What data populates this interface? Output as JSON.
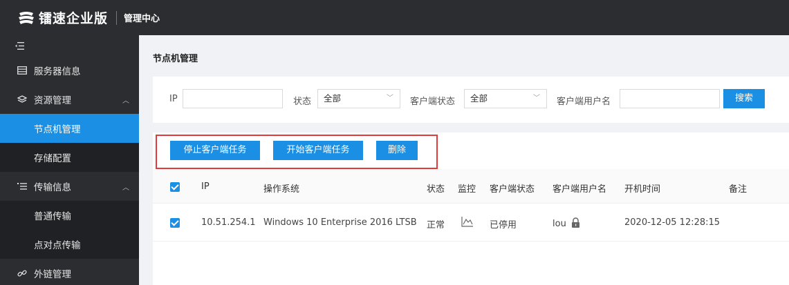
{
  "header": {
    "brand": "镭速企业版",
    "title": "管理中心"
  },
  "sidebar": {
    "toggle_icon": "menu-fold-icon",
    "items": [
      {
        "label": "服务器信息",
        "icon": "server-icon"
      },
      {
        "label": "资源管理",
        "icon": "layers-icon",
        "expanded": true,
        "children": [
          {
            "label": "节点机管理",
            "active": true
          },
          {
            "label": "存储配置"
          }
        ]
      },
      {
        "label": "传输信息",
        "icon": "list-icon",
        "expanded": true,
        "children": [
          {
            "label": "普通传输"
          },
          {
            "label": "点对点传输"
          }
        ]
      },
      {
        "label": "外链管理",
        "icon": "link-icon"
      }
    ]
  },
  "page": {
    "title": "节点机管理"
  },
  "filter": {
    "ip_label": "IP",
    "ip_value": "",
    "status_label": "状态",
    "status_value": "全部",
    "client_status_label": "客户端状态",
    "client_status_value": "全部",
    "client_user_label": "客户端用户名",
    "client_user_value": "",
    "search_button": "搜索"
  },
  "actions": {
    "stop": "停止客户端任务",
    "start": "开始客户端任务",
    "delete": "删除"
  },
  "table": {
    "columns": [
      "IP",
      "操作系统",
      "状态",
      "监控",
      "客户端状态",
      "客户端用户名",
      "开机时间",
      "备注"
    ],
    "rows": [
      {
        "checked": true,
        "ip": "10.51.254.1",
        "os": "Windows 10 Enterprise 2016 LTSB",
        "status": "正常",
        "monitor_icon": "chart-line-icon",
        "client_status": "已停用",
        "client_user": "lou",
        "client_user_icon": "lock-icon",
        "boot_time": "2020-12-05 12:28:15",
        "note": ""
      }
    ],
    "header_checked": true
  },
  "colors": {
    "accent": "#1a8fe3",
    "sidebar_bg": "#2b2d31",
    "highlight_border": "#e03a3a"
  }
}
